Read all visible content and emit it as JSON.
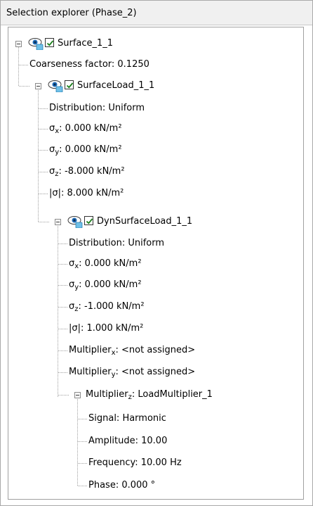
{
  "panel": {
    "title": "Selection explorer (Phase_2)"
  },
  "tree": {
    "surface": {
      "label": "Surface_1_1",
      "coarseness": "Coarseness factor: 0.1250",
      "surface_load": {
        "label": "SurfaceLoad_1_1",
        "distribution": "Distribution: Uniform",
        "sigma_x": {
          "sym": "σ",
          "sub": "x",
          "value": ": 0.000 kN/m²"
        },
        "sigma_y": {
          "sym": "σ",
          "sub": "y",
          "value": ": 0.000 kN/m²"
        },
        "sigma_z": {
          "sym": "σ",
          "sub": "z",
          "value": ": -8.000 kN/m²"
        },
        "sigma_abs": "|σ|: 8.000 kN/m²",
        "dyn_load": {
          "label": "DynSurfaceLoad_1_1",
          "distribution": "Distribution: Uniform",
          "sigma_x": {
            "sym": "σ",
            "sub": "x",
            "value": ": 0.000 kN/m²"
          },
          "sigma_y": {
            "sym": "σ",
            "sub": "y",
            "value": ": 0.000 kN/m²"
          },
          "sigma_z": {
            "sym": "σ",
            "sub": "z",
            "value": ": -1.000 kN/m²"
          },
          "sigma_abs": "|σ|: 1.000 kN/m²",
          "multiplier_x": {
            "sym": "Multiplier",
            "sub": "x",
            "value": ": <not assigned>"
          },
          "multiplier_y": {
            "sym": "Multiplier",
            "sub": "y",
            "value": ": <not assigned>"
          },
          "multiplier_z": {
            "sym": "Multiplier",
            "sub": "z",
            "value": ": LoadMultiplier_1",
            "signal": "Signal: Harmonic",
            "amplitude": "Amplitude: 10.00",
            "frequency": "Frequency: 10.00 Hz",
            "phase": "Phase: 0.000 °"
          }
        }
      }
    }
  },
  "icons": {
    "expander": "collapse-minus",
    "visibility": "eye-icon",
    "checkbox": "checked"
  },
  "colors": {
    "checkmark": "#1a7f1a",
    "eye": "#1e6bb8",
    "tree_line": "#a0a0a0"
  }
}
